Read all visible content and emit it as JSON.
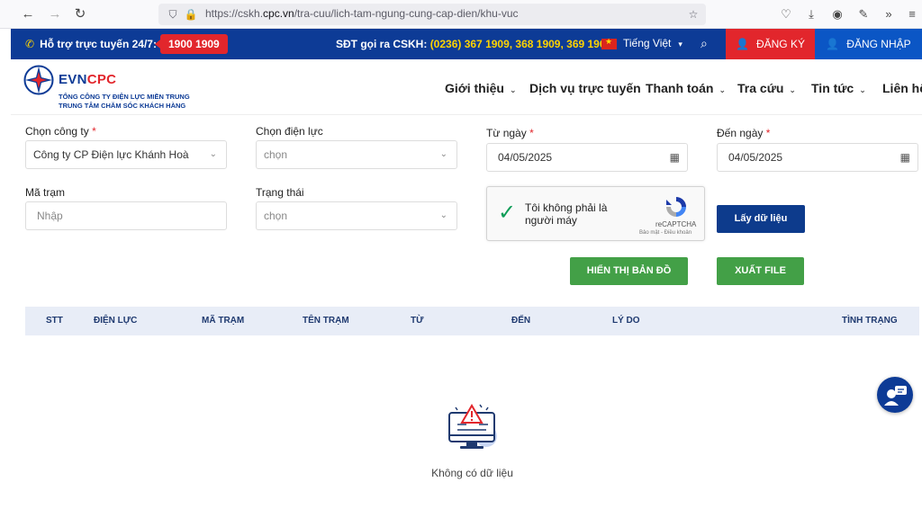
{
  "browser": {
    "url_prefix": "https://cskh.",
    "url_domain": "cpc.vn",
    "url_path": "/tra-cuu/lich-tam-ngung-cung-cap-dien/khu-vuc"
  },
  "topbar": {
    "support_label": "Hỗ trợ trực tuyến 24/7:",
    "hotline": "1900 1909",
    "phone_label": "SĐT gọi ra CSKH:",
    "phone_numbers": "(0236) 367 1909, 368 1909, 369 1909",
    "language": "Tiếng Việt",
    "register": "ĐĂNG KÝ",
    "login": "ĐĂNG NHẬP"
  },
  "header": {
    "logo_prefix": "EVN",
    "logo_suffix": "CPC",
    "logo_sub1": "TỔNG CÔNG TY ĐIỆN LỰC MIỀN TRUNG",
    "logo_sub2": "TRUNG TÂM CHĂM SÓC KHÁCH HÀNG",
    "menu": [
      "Giới thiệu",
      "Dịch vụ trực tuyến",
      "Thanh toán",
      "Tra cứu",
      "Tin tức",
      "Liên hệ"
    ]
  },
  "form": {
    "company_label": "Chọn công ty",
    "company_value": "Công ty CP Điện lực Khánh Hoà",
    "power_label": "Chọn điện lực",
    "power_placeholder": "chọn",
    "from_label": "Từ ngày",
    "from_value": "04/05/2025",
    "to_label": "Đến ngày",
    "to_value": "04/05/2025",
    "station_label": "Mã trạm",
    "station_placeholder": "Nhập",
    "status_label": "Trạng thái",
    "status_placeholder": "chọn",
    "required_mark": "*"
  },
  "captcha": {
    "text": "Tôi không phải là người máy",
    "brand": "reCAPTCHA",
    "terms": "Bảo mật - Điều khoản"
  },
  "buttons": {
    "fetch": "Lấy dữ liệu",
    "map": "HIỂN THỊ BẢN ĐỒ",
    "export": "XUẤT FILE"
  },
  "table": {
    "columns": [
      "STT",
      "ĐIỆN LỰC",
      "MÃ TRẠM",
      "TÊN TRẠM",
      "TỪ",
      "ĐẾN",
      "LÝ DO",
      "TÌNH TRẠNG"
    ],
    "empty_text": "Không có dữ liệu"
  },
  "colors": {
    "brand_blue": "#0d3b96",
    "brand_red": "#e2262c",
    "accent_green": "#43a047"
  }
}
